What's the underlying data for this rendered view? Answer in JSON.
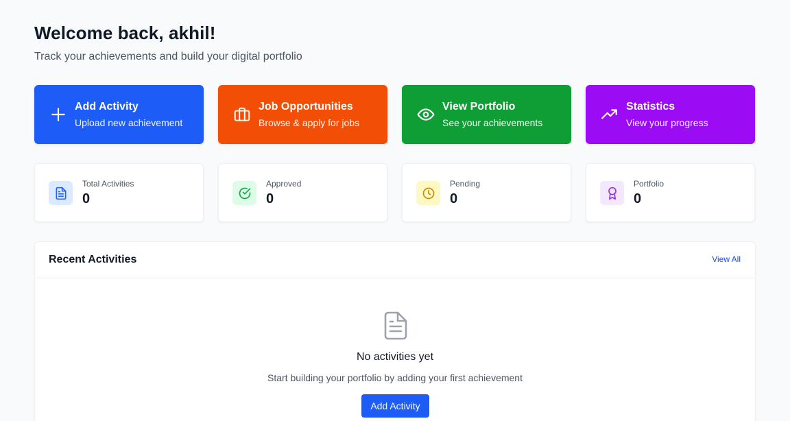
{
  "header": {
    "title": "Welcome back, akhil!",
    "subtitle": "Track your achievements and build your digital portfolio"
  },
  "actions": [
    {
      "label": "Add Activity",
      "sub": "Upload new achievement",
      "icon": "plus-icon",
      "color": "#1d5cf6"
    },
    {
      "label": "Job Opportunities",
      "sub": "Browse & apply for jobs",
      "icon": "briefcase-icon",
      "color": "#f24e06"
    },
    {
      "label": "View Portfolio",
      "sub": "See your achievements",
      "icon": "eye-icon",
      "color": "#0f9d36"
    },
    {
      "label": "Statistics",
      "sub": "View your progress",
      "icon": "trending-up-icon",
      "color": "#9b0cf5"
    }
  ],
  "stats": [
    {
      "label": "Total Activities",
      "value": "0",
      "icon": "document-icon",
      "icon_color": "#2563eb",
      "icon_bg": "#dbeafe"
    },
    {
      "label": "Approved",
      "value": "0",
      "icon": "check-circle-icon",
      "icon_color": "#16a34a",
      "icon_bg": "#dcfce7"
    },
    {
      "label": "Pending",
      "value": "0",
      "icon": "clock-icon",
      "icon_color": "#ca8a04",
      "icon_bg": "#fef9c3"
    },
    {
      "label": "Portfolio",
      "value": "0",
      "icon": "award-icon",
      "icon_color": "#9333ea",
      "icon_bg": "#f3e8ff"
    }
  ],
  "recent": {
    "title": "Recent Activities",
    "view_all": "View All",
    "empty_icon": "document-icon",
    "empty_title": "No activities yet",
    "empty_sub": "Start building your portfolio by adding your first achievement",
    "button": "Add Activity"
  }
}
